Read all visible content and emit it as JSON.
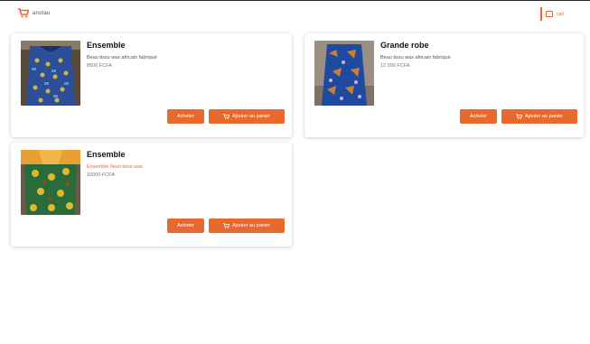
{
  "header": {
    "logo_text": "anotau",
    "right_text": "cart"
  },
  "products": [
    {
      "title": "Ensemble",
      "description": "Beau tissu wax africain fabriqué",
      "price": "8500 FCFA",
      "buy_label": "Acheter",
      "cart_label": "Ajouter au panier"
    },
    {
      "title": "Grande robe",
      "description": "Beau tissu wax africain fabriqué",
      "price": "12 000 FCFA",
      "buy_label": "Acheter",
      "cart_label": "Ajouter au panier"
    },
    {
      "title": "Ensemble",
      "description": "Ensemble fleuri tissu wax",
      "price": "10000 FCFA",
      "buy_label": "Acheter",
      "cart_label": "Ajouter au panier"
    }
  ],
  "colors": {
    "accent": "#e8692d",
    "topline": "#2b2b2b"
  },
  "icons": {
    "logo": "shopping-cart-logo-icon",
    "cart": "cart-icon"
  }
}
